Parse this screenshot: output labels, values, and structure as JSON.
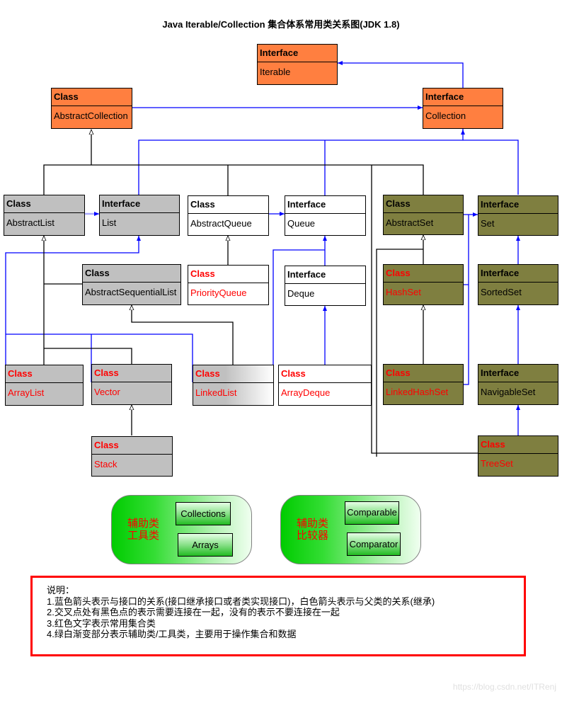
{
  "title": "Java Iterable/Collection 集合体系常用类关系图(JDK 1.8)",
  "nodes": {
    "iterable": {
      "kind": "Interface",
      "name": "Iterable",
      "highlight": false,
      "color": "orange"
    },
    "abstract_collection": {
      "kind": "Class",
      "name": "AbstractCollection",
      "highlight": false,
      "color": "orange"
    },
    "collection": {
      "kind": "Interface",
      "name": "Collection",
      "highlight": false,
      "color": "orange"
    },
    "abstract_list": {
      "kind": "Class",
      "name": "AbstractList",
      "highlight": false,
      "color": "gray"
    },
    "list": {
      "kind": "Interface",
      "name": "List",
      "highlight": false,
      "color": "gray"
    },
    "abstract_queue": {
      "kind": "Class",
      "name": "AbstractQueue",
      "highlight": false,
      "color": "white"
    },
    "queue": {
      "kind": "Interface",
      "name": "Queue",
      "highlight": false,
      "color": "white"
    },
    "abstract_set": {
      "kind": "Class",
      "name": "AbstractSet",
      "highlight": false,
      "color": "olive"
    },
    "set": {
      "kind": "Interface",
      "name": "Set",
      "highlight": false,
      "color": "olive"
    },
    "abstract_sequential_list": {
      "kind": "Class",
      "name": "AbstractSequentialList",
      "highlight": false,
      "color": "gray"
    },
    "priority_queue": {
      "kind": "Class",
      "name": "PriorityQueue",
      "highlight": true,
      "color": "white"
    },
    "deque": {
      "kind": "Interface",
      "name": "Deque",
      "highlight": false,
      "color": "white"
    },
    "hash_set": {
      "kind": "Class",
      "name": "HashSet",
      "highlight": true,
      "color": "olive"
    },
    "sorted_set": {
      "kind": "Interface",
      "name": "SortedSet",
      "highlight": false,
      "color": "olive"
    },
    "array_list": {
      "kind": "Class",
      "name": "ArrayList",
      "highlight": true,
      "color": "gray"
    },
    "vector": {
      "kind": "Class",
      "name": "Vector",
      "highlight": true,
      "color": "gray"
    },
    "linked_list": {
      "kind": "Class",
      "name": "LinkedList",
      "highlight": true,
      "color": "gradient"
    },
    "array_deque": {
      "kind": "Class",
      "name": "ArrayDeque",
      "highlight": true,
      "color": "white"
    },
    "linked_hash_set": {
      "kind": "Class",
      "name": "LinkedHashSet",
      "highlight": true,
      "color": "olive"
    },
    "navigable_set": {
      "kind": "Interface",
      "name": "NavigableSet",
      "highlight": false,
      "color": "olive"
    },
    "stack": {
      "kind": "Class",
      "name": "Stack",
      "highlight": true,
      "color": "gray"
    },
    "tree_set": {
      "kind": "Class",
      "name": "TreeSet",
      "highlight": true,
      "color": "olive"
    }
  },
  "helpers": [
    {
      "label_line1": "辅助类",
      "label_line2": "工具类",
      "items": [
        "Collections",
        "Arrays"
      ]
    },
    {
      "label_line1": "辅助类",
      "label_line2": "比较器",
      "items": [
        "Comparable",
        "Comparator"
      ]
    }
  ],
  "notes": {
    "heading": "说明：",
    "lines": [
      "1.蓝色箭头表示与接口的关系(接口继承接口或者类实现接口)，白色箭头表示与父类的关系(继承)",
      "2.交叉点处有黑色点的表示需要连接在一起，没有的表示不要连接在一起",
      "3.红色文字表示常用集合类",
      "4.绿白渐变部分表示辅助类/工具类，主要用于操作集合和数据"
    ]
  },
  "watermark": "https://blog.csdn.net/ITRenj",
  "colors": {
    "orange": "#ff7f40",
    "gray": "#c0c0c0",
    "olive": "#7f7f40",
    "interface_arrow": "#0000ff",
    "inherit_line": "#000000",
    "highlight_text": "#ff0000",
    "notes_border": "#ff0000"
  }
}
